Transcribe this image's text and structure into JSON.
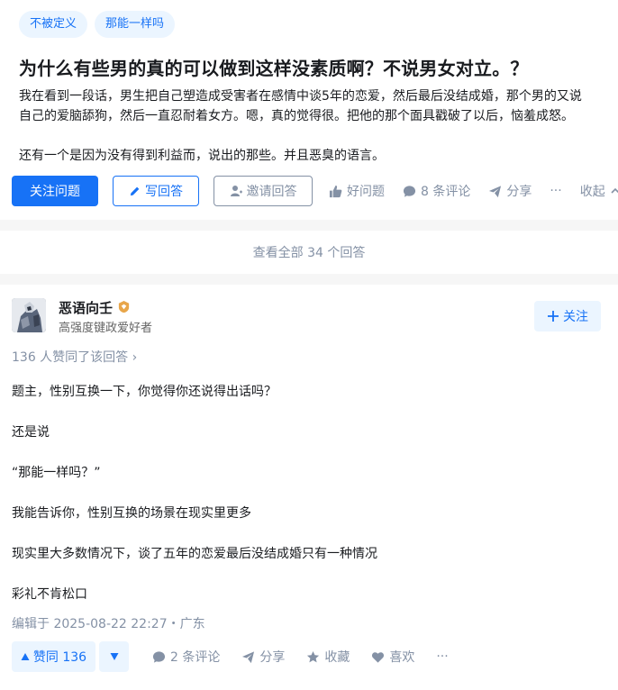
{
  "question": {
    "tags": [
      "不被定义",
      "那能一样吗"
    ],
    "title": "为什么有些男的真的可以做到这样没素质啊？不说男女对立。？",
    "body_lines": [
      "我在看到一段话，男生把自己塑造成受害者在感情中谈5年的恋爱，然后最后没结成婚，那个男的又说",
      "自己的爱脑舔狗，然后一直忍耐着女方。嗯，真的觉得很。把他的那个面具戳破了以后，恼羞成怒。",
      "还有一个是因为没有得到利益而，说出的那些。并且恶臭的语言。"
    ],
    "actions": {
      "follow": "关注问题",
      "write": "写回答",
      "invite": "邀请回答",
      "good": "好问题",
      "comments": "8 条评论",
      "share": "分享",
      "more": "···",
      "collapse": "收起"
    }
  },
  "view_all": "查看全部 34 个回答",
  "answer": {
    "author": {
      "name": "恶语向壬",
      "bio": "高强度键政爱好者",
      "follow": "关注"
    },
    "vote_summary": "136 人赞同了该回答 ›",
    "paragraphs": [
      "题主，性别互换一下，你觉得你还说得出话吗？",
      "还是说",
      "“那能一样吗？”",
      "我能告诉你，性别互换的场景在现实里更多",
      "现实里大多数情况下，谈了五年的恋爱最后没结成婚只有一种情况",
      "彩礼不肯松口"
    ],
    "edited": "编辑于 2025-08-22 22:27・广东",
    "actions": {
      "upvote": "赞同 136",
      "comments": "2 条评论",
      "share": "分享",
      "collect": "收藏",
      "like": "喜欢",
      "more": "···"
    }
  },
  "colors": {
    "brand": "#1772f6",
    "brand_light": "#ebf5ff",
    "meta_grey": "#8491a5",
    "text": "#191b1f"
  }
}
